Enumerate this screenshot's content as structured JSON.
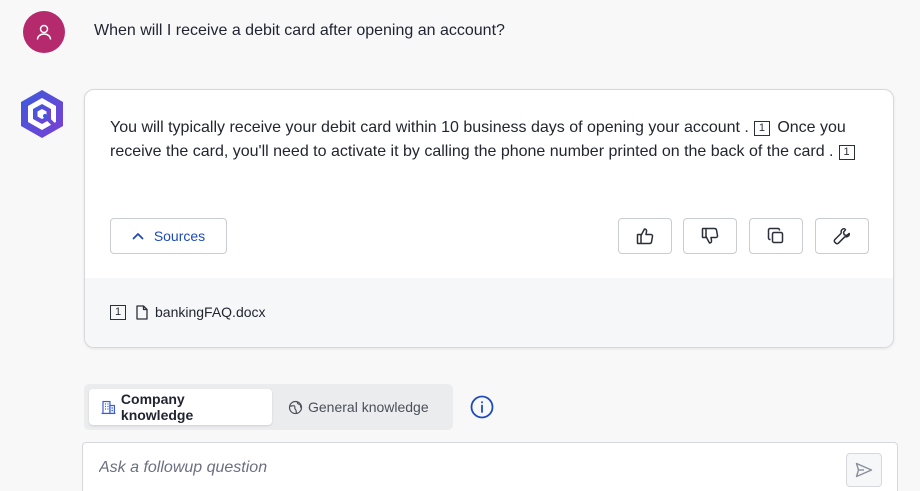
{
  "conversation": {
    "user_question": "When will I receive a debit card after opening an account?",
    "answer": {
      "sentence_1": "You will typically receive your debit card within 10 business days of opening your account .",
      "citation_1": "1",
      "sentence_2": "Once you receive the card, you'll need to activate it by calling the phone number printed on the back of the card .",
      "citation_2": "1"
    },
    "sources_button_label": "Sources",
    "sources": [
      {
        "index": "1",
        "file_name": "bankingFAQ.docx",
        "icon": "document-icon"
      }
    ],
    "actions": [
      {
        "name": "thumbs-up",
        "icon": "thumbs-up-icon"
      },
      {
        "name": "thumbs-down",
        "icon": "thumbs-down-icon"
      },
      {
        "name": "copy",
        "icon": "copy-icon"
      },
      {
        "name": "settings",
        "icon": "wrench-icon"
      }
    ]
  },
  "knowledge_toggle": {
    "company_label": "Company knowledge",
    "general_label": "General knowledge",
    "selected": "Company knowledge"
  },
  "followup": {
    "placeholder": "Ask a followup question",
    "value": ""
  },
  "colors": {
    "user_avatar": "#b42a6c",
    "brand_accent": "#1f4bb8",
    "logo_purple": "#5b3fd4",
    "background": "#f8f8f9"
  }
}
